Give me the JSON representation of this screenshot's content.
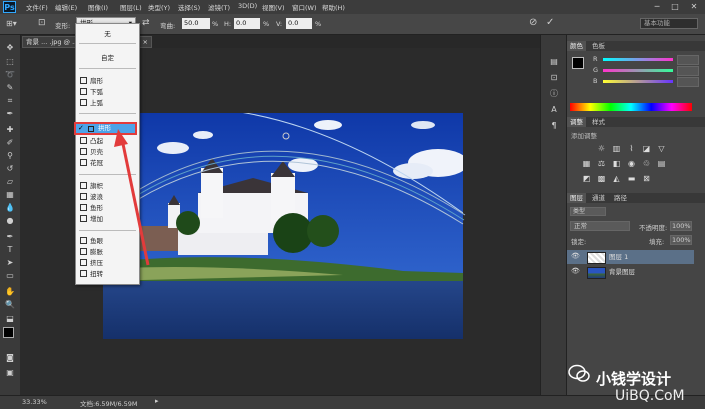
{
  "menubar": {
    "logo": "Ps",
    "items": [
      "文件(F)",
      "编辑(E)",
      "图像(I)",
      "图层(L)",
      "类型(Y)",
      "选择(S)",
      "滤镜(T)",
      "3D(D)",
      "视图(V)",
      "窗口(W)",
      "帮助(H)"
    ],
    "minimize": "─",
    "maximize": "□",
    "close": "✕"
  },
  "options": {
    "warp_label": "变形:",
    "warp_value": "拱形",
    "bend_label": "弯曲:",
    "bend_value": "50.0",
    "h_label": "H:",
    "h_value": "0.0",
    "v_label": "V:",
    "v_value": "0.0",
    "pct": "%",
    "workspace": "基本功能"
  },
  "document": {
    "tab_label": "背景 ... .jpg @ ...",
    "zoom": "33.33%",
    "doc_size": "文档:6.59M/6.59M"
  },
  "warp_menu": {
    "items": [
      "无",
      "自定",
      "扇形",
      "下弧",
      "上弧",
      "拱形",
      "凸起",
      "贝壳",
      "花冠",
      "旗帜",
      "波浪",
      "鱼形",
      "增加",
      "鱼眼",
      "膨胀",
      "挤压",
      "扭转"
    ],
    "selected": "拱形"
  },
  "panels": {
    "color_tabs": [
      "颜色",
      "色板"
    ],
    "channel_r": "R",
    "channel_g": "G",
    "channel_b": "B",
    "adjust_tabs": [
      "调整",
      "样式"
    ],
    "adjust_hint": "添加调整",
    "layer_tabs": [
      "图层",
      "通道",
      "路径"
    ],
    "kind": "类型",
    "blend_mode": "正常",
    "opacity_label": "不透明度:",
    "opacity": "100%",
    "lock_label": "锁定:",
    "fill_label": "填充:",
    "fill": "100%",
    "layers": [
      "图层 1",
      "背景图层"
    ]
  },
  "watermark": {
    "text": "小钱学设计",
    "url": "UiBQ.CoM"
  },
  "colors": {
    "accent_red": "#e23b3b",
    "selection_blue": "#4da3e8",
    "sky": "#1f4fb8"
  }
}
